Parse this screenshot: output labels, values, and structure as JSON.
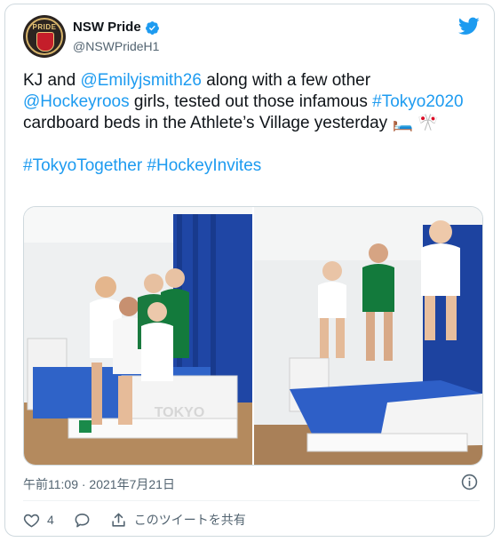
{
  "author": {
    "display_name": "NSW Pride",
    "handle": "@NSWPrideH1",
    "avatar_text": "PRIDE"
  },
  "tweet": {
    "t1": "KJ and ",
    "m1": "@Emilyjsmith26",
    "t2": " along with a few other ",
    "m2": "@Hockeyroos",
    "t3": " girls, tested out those infamous ",
    "h1": "#Tokyo2020",
    "t4": " cardboard beds in the Athlete’s Village yesterday 🛏️ 🎌",
    "h2": "#TokyoTogether",
    "h3": "#HockeyInvites"
  },
  "photos": [
    {
      "bed_text": "TOKYO"
    },
    {
      "bed_text": ""
    }
  ],
  "meta": {
    "timestamp": "午前11:09 · 2021年7月21日"
  },
  "actions": {
    "like_count": "4",
    "share_label": "このツイートを共有"
  },
  "colors": {
    "link": "#1d9bf0",
    "secondary": "#536471",
    "border": "#cfd9de"
  }
}
